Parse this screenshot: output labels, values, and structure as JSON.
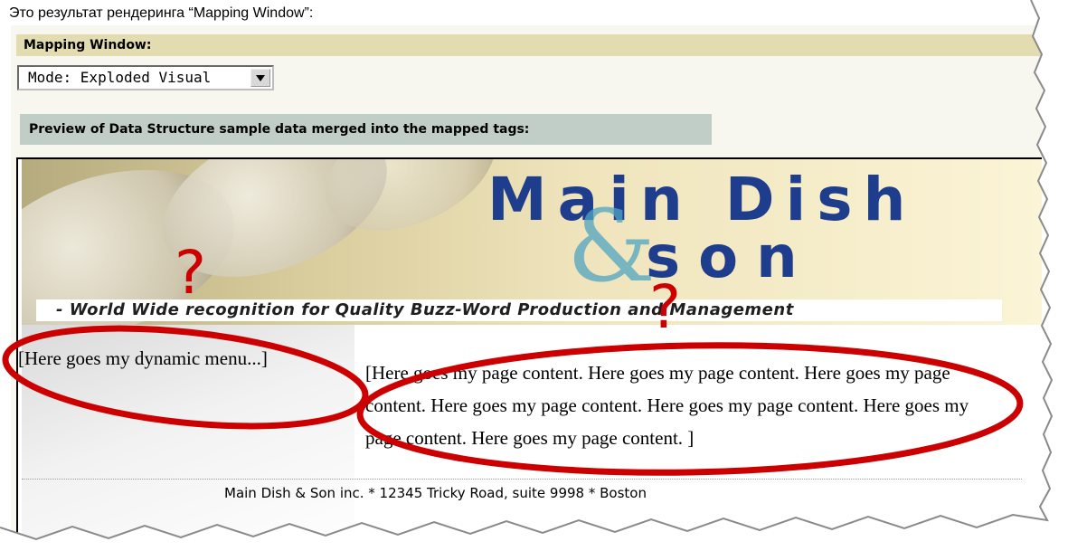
{
  "caption": "Это результат рендеринга “Mapping Window”:",
  "panel": {
    "header": "Mapping Window:",
    "mode_select": "Mode: Exploded Visual",
    "preview_label": "Preview of Data Structure sample data merged into the mapped tags:"
  },
  "preview": {
    "brand": {
      "title": "Main Dish",
      "amp": "&",
      "sub": "son"
    },
    "tagline": "- World Wide recognition for Quality Buzz-Word Production and Management",
    "menu_text": "[Here goes my dynamic menu...]",
    "content_text": "[Here goes my page content. Here goes my page content. Here goes my page content. Here goes my page content. Here goes my page content. Here goes my page content. Here goes my page content. ]",
    "footer": "Main Dish & Son inc. * 12345 Tricky Road, suite 9998 * Boston"
  },
  "annotations": {
    "mark1": "?",
    "mark2": "?",
    "color": "#cc0000"
  },
  "colors": {
    "header_bg": "#e3dcb1",
    "preview_label_bg": "#c1cec8",
    "brand_blue": "#1e3d8c",
    "brand_teal": "#4fa5c2"
  }
}
